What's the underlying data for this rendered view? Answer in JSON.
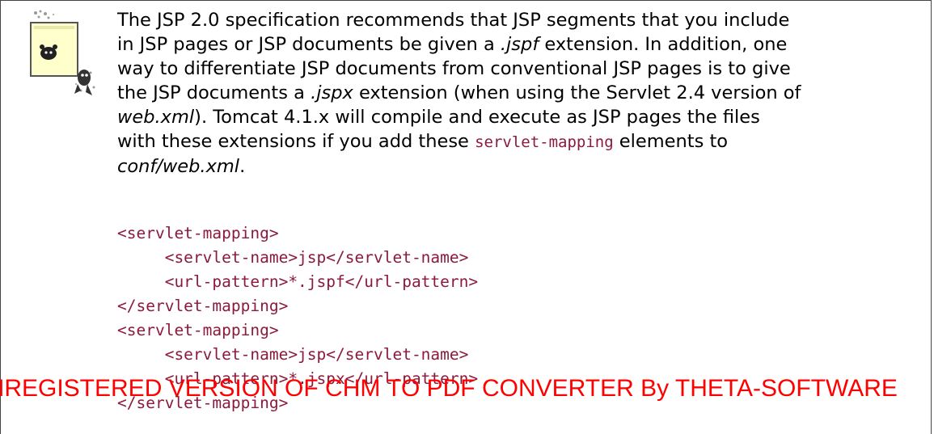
{
  "note": {
    "icon": "note-icon",
    "paragraph": {
      "l1": "The JSP 2.0 specification recommends that JSP segments that you include",
      "l2a": "in JSP pages or JSP documents be given a ",
      "l2_ext": ".jspf",
      "l2b": " extension. In addition, one",
      "l3": "way to differentiate JSP documents from conventional JSP pages is to give",
      "l4a": "the JSP documents a ",
      "l4_ext": ".jspx",
      "l4b": " extension (when using the Servlet 2.4 version of",
      "l5_file": "web.xml",
      "l5b": "). Tomcat 4.1.x will compile and execute as JSP pages the files",
      "l6a": "with these extensions if you add these ",
      "l6_code": "servlet-mapping",
      "l6b": " elements to",
      "l7_file": "conf/web.xml",
      "l7b": "."
    },
    "code_lines": [
      "<servlet-mapping>",
      "     <servlet-name>jsp</servlet-name>",
      "     <url-pattern>*.jspf</url-pattern>",
      "</servlet-mapping>",
      "<servlet-mapping>",
      "     <servlet-name>jsp</servlet-name>",
      "     <url-pattern>*.jspx</url-pattern>",
      "</servlet-mapping>"
    ]
  },
  "watermark": "UNREGISTERED VERSION OF CHM TO PDF CONVERTER By THETA-SOFTWARE",
  "colors": {
    "code": "#8b1a3c",
    "watermark": "#ff0000",
    "border": "#444444"
  }
}
